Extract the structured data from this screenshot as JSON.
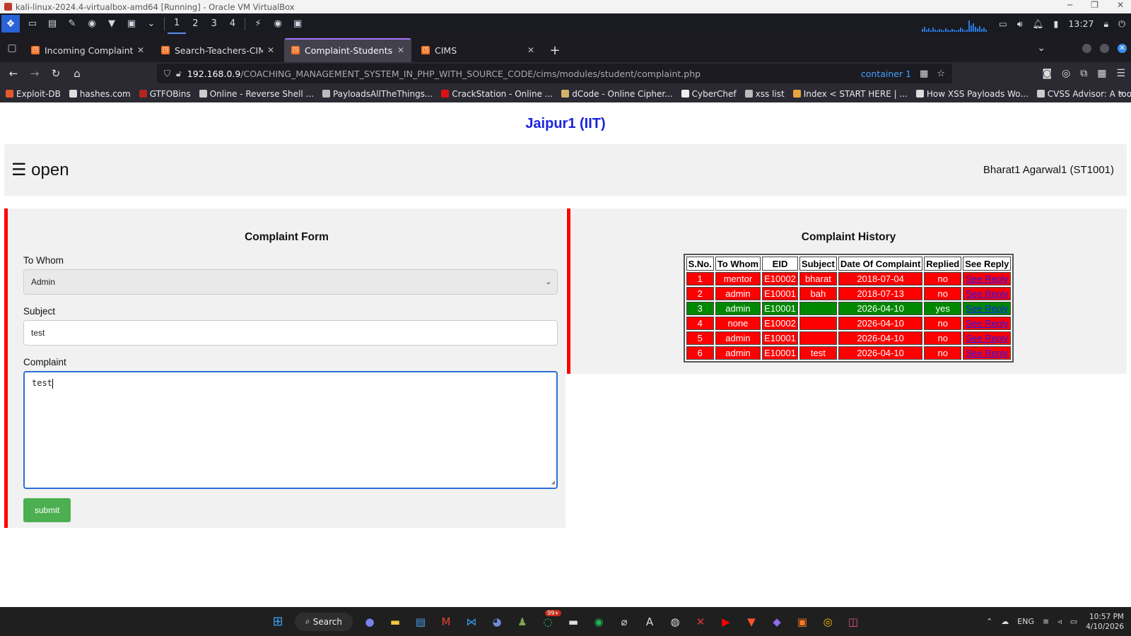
{
  "vbox": {
    "title": "kali-linux-2024.4-virtualbox-amd64 [Running] - Oracle VM VirtualBox"
  },
  "kali": {
    "workspaces": [
      "1",
      "2",
      "3",
      "4"
    ],
    "clock": "13:27"
  },
  "browser": {
    "tabs": [
      {
        "title": "Incoming Complaints-CIMS"
      },
      {
        "title": "Search-Teachers-CIMS"
      },
      {
        "title": "Complaint-Students-CIMS"
      },
      {
        "title": "CIMS"
      }
    ],
    "url": {
      "host": "192.168.0.9",
      "path": "/COACHING_MANAGEMENT_SYSTEM_IN_PHP_WITH_SOURCE_CODE/cims/modules/student/complaint.php",
      "container": "container 1"
    },
    "bookmarks": [
      {
        "label": "Exploit-DB",
        "color": "#e8582c"
      },
      {
        "label": "hashes.com",
        "color": "#dddddd"
      },
      {
        "label": "GTFOBins",
        "color": "#b3261e"
      },
      {
        "label": "Online - Reverse Shell ...",
        "color": "#cccccc"
      },
      {
        "label": "PayloadsAllTheThings...",
        "color": "#bbbbbb"
      },
      {
        "label": "CrackStation - Online ...",
        "color": "#d11"
      },
      {
        "label": "dCode - Online Cipher...",
        "color": "#d4b36a"
      },
      {
        "label": "CyberChef",
        "color": "#eeeeee"
      },
      {
        "label": "xss list",
        "color": "#bbbbbb"
      },
      {
        "label": "Index < START HERE | ...",
        "color": "#e8a33d"
      },
      {
        "label": "How XSS Payloads Wo...",
        "color": "#dddddd"
      },
      {
        "label": "CVSS Advisor: A tool t...",
        "color": "#cccccc"
      }
    ]
  },
  "site": {
    "brand": "Jaipur1 (IIT)",
    "menu_label": "☰ open",
    "user": "Bharat1 Agarwal1 (ST1001)"
  },
  "form": {
    "title": "Complaint Form",
    "to_whom_label": "To Whom",
    "to_whom_value": "Admin",
    "subject_label": "Subject",
    "subject_value": "test",
    "complaint_label": "Complaint",
    "complaint_value": "test",
    "submit_label": "submit"
  },
  "history": {
    "title": "Complaint History",
    "headers": [
      "S.No.",
      "To Whom",
      "EID",
      "Subject",
      "Date Of Complaint",
      "Replied",
      "See Reply"
    ],
    "rows": [
      {
        "sno": "1",
        "to": "mentor",
        "eid": "E10002",
        "subject": "bharat",
        "date": "2018-07-04",
        "replied": "no",
        "link": "See Reply"
      },
      {
        "sno": "2",
        "to": "admin",
        "eid": "E10001",
        "subject": "bah",
        "date": "2018-07-13",
        "replied": "no",
        "link": "See Reply"
      },
      {
        "sno": "3",
        "to": "admin",
        "eid": "E10001",
        "subject": "",
        "date": "2026-04-10",
        "replied": "yes",
        "link": "See Reply"
      },
      {
        "sno": "4",
        "to": "none",
        "eid": "E10002",
        "subject": "",
        "date": "2026-04-10",
        "replied": "no",
        "link": "See Reply"
      },
      {
        "sno": "5",
        "to": "admin",
        "eid": "E10001",
        "subject": "",
        "date": "2026-04-10",
        "replied": "no",
        "link": "See Reply"
      },
      {
        "sno": "6",
        "to": "admin",
        "eid": "E10001",
        "subject": "test",
        "date": "2026-04-10",
        "replied": "no",
        "link": "See Reply"
      }
    ]
  },
  "taskbar": {
    "search_label": "Search",
    "whatsapp_badge": "99+",
    "lang": "ENG",
    "time": "10:57 PM",
    "date": "4/10/2026"
  },
  "colors": {
    "accent_red": "#ff0000",
    "accent_green": "#008800",
    "brand_blue": "#1a24e0",
    "submit_green": "#4caf50"
  }
}
